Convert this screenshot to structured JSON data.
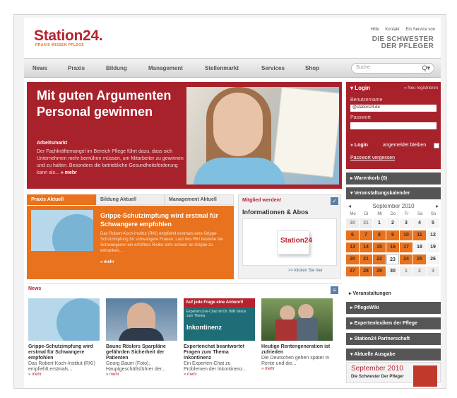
{
  "header": {
    "logo_main": "Station24.",
    "tagline": "PRAXIS WISSEN PFLEGE",
    "top_links": [
      "Hilfe",
      "Kontakt",
      "Ein Service von"
    ],
    "partner_line1": "DIE SCHWESTER",
    "partner_line2": "DER PFLEGER"
  },
  "nav": {
    "items": [
      "News",
      "Praxis",
      "Bildung",
      "Management",
      "Stellenmarkt",
      "Services",
      "Shop"
    ],
    "search_placeholder": "Suche"
  },
  "hero": {
    "title": "Mit guten Argumenten Personal gewinnen",
    "kicker": "Arbeitsmarkt",
    "text": "Der Fachkräftemangel im Bereich Pflege führt dazu, dass sich Unternehmen mehr bemühen müssen, um Mitarbeiter zu gewinnen und zu halten. Besonders die betriebliche Gesundheitsförderung kann als...",
    "more": "» mehr"
  },
  "tabs": [
    "Praxis Aktuell",
    "Bildung Aktuell",
    "Management Aktuell"
  ],
  "praxis": {
    "title": "Grippe-Schutzimpfung wird erstmal für Schwangere empfohlen",
    "text": "Das Robert-Koch-Institut (RKI) empfiehlt erstmals eine Grippe-Schutzimpfung für schwangere Frauen. Laut des RKI bestehe bei Schwangeren ein erhöhtes Risiko sehr schwer an Grippe zu erkranken...",
    "more": "» mehr"
  },
  "mitglied": {
    "label": "Mitglied werden!",
    "title": "Informationen & Abos",
    "logo_text": "Station24",
    "link": ">> klicken Sie hier"
  },
  "news": {
    "heading": "News",
    "items": [
      {
        "title": "Grippe-Schutzimpfung wird erstmal für Schwangere empfohlen",
        "text": "Das Robert-Koch-Institut (RKI) empfiehlt erstmals...",
        "more": "» mehr"
      },
      {
        "title": "Baunc Röslers Sparpläne gefährden Sicherheit der Patienten",
        "text": "Georg Baum (Foto), Hauptgeschäftsführer der...",
        "more": "» mehr"
      },
      {
        "title": "Expertenchat beantwortet Fragen zum Thema Inkontinenz",
        "text": "Ein Experten-Chat zu Problemen der Inkontinenz...",
        "more": "» mehr",
        "thumb_head": "Auf jede Frage eine Antwort!",
        "thumb_sub": "Experten Live-Chat mit Dr. Willi Vance zum Thema",
        "thumb_big": "Inkontinenz"
      },
      {
        "title": "Heutige Rentengeneration ist zufrieden",
        "text": "Die Deutschen gehen später in Rente und die...",
        "more": "» mehr"
      }
    ]
  },
  "login": {
    "heading": "▾ Login",
    "register": "» Neu registrieren",
    "user_label": "Benutzername",
    "user_value": "@station24.de",
    "pass_label": "Passwort",
    "button": "» Login",
    "remember": "angemeldet bleiben",
    "forgot": "Passwort vergessen"
  },
  "sidebar": {
    "warenkorb": "▸ Warenkorb (0)",
    "kalender": "▾ Veranstaltungskalender",
    "veranstaltungen": "▸ Veranstaltungen",
    "pflegewiki": "▸ PflegeWiki",
    "lexiken": "▸ Expertenlexiken der Pflege",
    "partnerschaft": "▸ Station24 Partnerschaft",
    "ausgabe": "▾ Aktuelle Ausgabe"
  },
  "calendar": {
    "month": "September 2010",
    "prev": "◂",
    "next": "▸",
    "dow": [
      "Mo",
      "Di",
      "Mi",
      "Do",
      "Fr",
      "Sa",
      "So"
    ],
    "weeks": [
      [
        {
          "d": "30",
          "s": "out"
        },
        {
          "d": "31",
          "s": "out"
        },
        {
          "d": "1",
          "s": "plain"
        },
        {
          "d": "2",
          "s": "plain"
        },
        {
          "d": "3",
          "s": "plain"
        },
        {
          "d": "4",
          "s": "plain"
        },
        {
          "d": "5",
          "s": "plain"
        }
      ],
      [
        {
          "d": "6",
          "s": "ev"
        },
        {
          "d": "7",
          "s": "ev"
        },
        {
          "d": "8",
          "s": "ev"
        },
        {
          "d": "9",
          "s": "ev"
        },
        {
          "d": "10",
          "s": "ev"
        },
        {
          "d": "11",
          "s": "ev"
        },
        {
          "d": "12",
          "s": "plain"
        }
      ],
      [
        {
          "d": "13",
          "s": "ev"
        },
        {
          "d": "14",
          "s": "ev"
        },
        {
          "d": "15",
          "s": "ev"
        },
        {
          "d": "16",
          "s": "ev"
        },
        {
          "d": "17",
          "s": "ev"
        },
        {
          "d": "18",
          "s": "plain"
        },
        {
          "d": "19",
          "s": "plain"
        }
      ],
      [
        {
          "d": "20",
          "s": "ev"
        },
        {
          "d": "21",
          "s": "ev"
        },
        {
          "d": "22",
          "s": "ev"
        },
        {
          "d": "23",
          "s": "today"
        },
        {
          "d": "24",
          "s": "ev"
        },
        {
          "d": "25",
          "s": "ev"
        },
        {
          "d": "26",
          "s": "plain"
        }
      ],
      [
        {
          "d": "27",
          "s": "ev"
        },
        {
          "d": "28",
          "s": "ev"
        },
        {
          "d": "29",
          "s": "ev"
        },
        {
          "d": "30",
          "s": "plain"
        },
        {
          "d": "1",
          "s": "out"
        },
        {
          "d": "2",
          "s": "out"
        },
        {
          "d": "3",
          "s": "out"
        }
      ]
    ]
  },
  "ausgabe": {
    "month": "September 2010",
    "title": "Die Schwester Der Pfleger"
  },
  "colors": {
    "brand_red": "#a8222c",
    "brand_orange": "#e8721d",
    "dark_bar": "#555555"
  }
}
